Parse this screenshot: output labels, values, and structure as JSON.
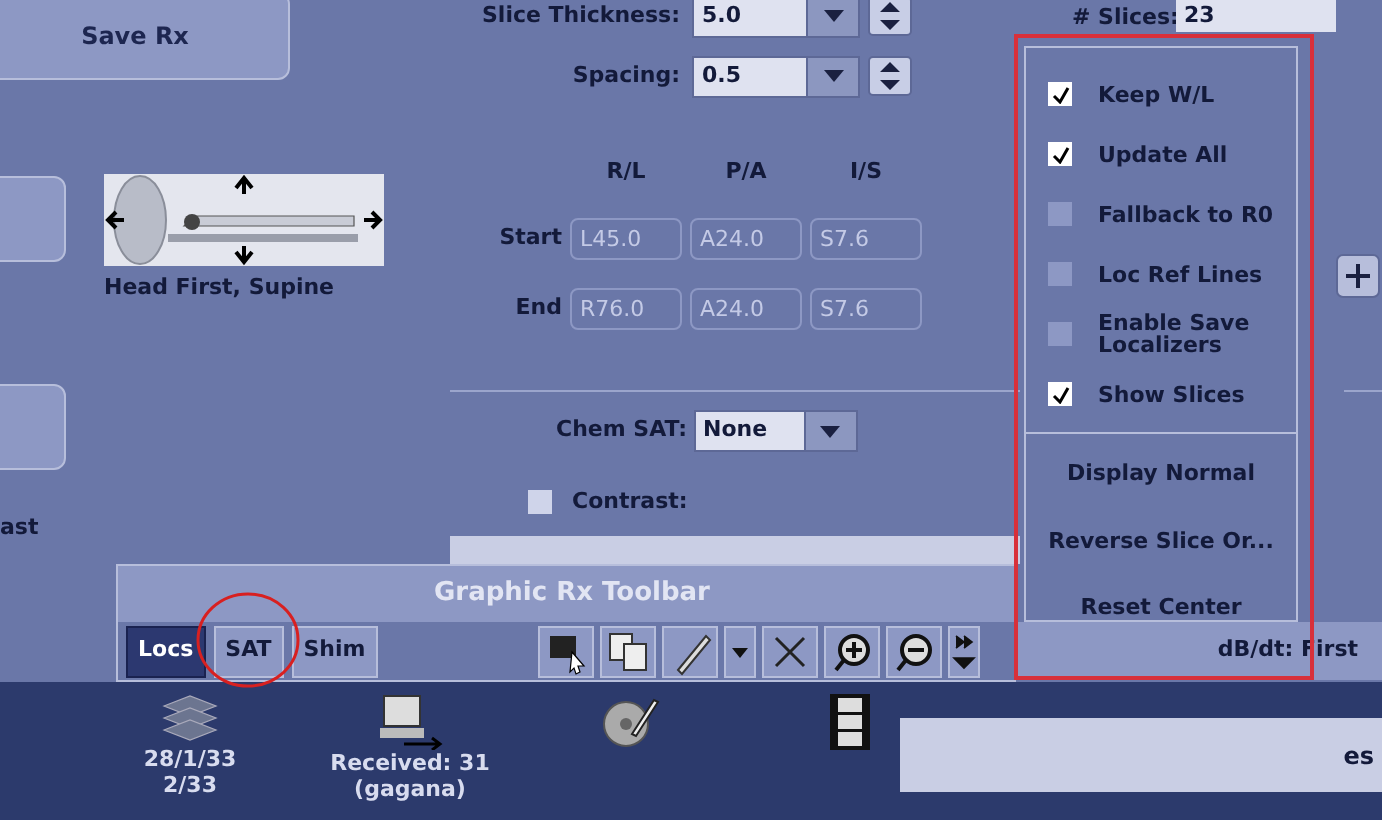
{
  "left_panel": {
    "save_button": "Save Rx",
    "cut_label": "ast",
    "patient_position": "Head First, Supine"
  },
  "slice_params": {
    "thickness_label": "Slice Thickness:",
    "thickness_value": "5.0",
    "spacing_label": "Spacing:",
    "spacing_value": "0.5",
    "slices_label": "# Slices:",
    "slices_value": "23"
  },
  "coords": {
    "columns": [
      "R/L",
      "P/A",
      "I/S"
    ],
    "rows": [
      {
        "label": "Start",
        "values": [
          "L45.0",
          "A24.0",
          "S7.6"
        ]
      },
      {
        "label": "End",
        "values": [
          "R76.0",
          "A24.0",
          "S7.6"
        ]
      }
    ]
  },
  "chem_sat": {
    "label": "Chem SAT:",
    "value": "None"
  },
  "contrast": {
    "label": "Contrast:",
    "checked": false
  },
  "menu": [
    {
      "kind": "check",
      "label": "Keep W/L",
      "checked": true
    },
    {
      "kind": "check",
      "label": "Update All",
      "checked": true
    },
    {
      "kind": "check",
      "label": "Fallback to R0",
      "checked": false
    },
    {
      "kind": "check",
      "label": "Loc Ref Lines",
      "checked": false
    },
    {
      "kind": "check",
      "label": "Enable Save Localizers",
      "checked": false
    },
    {
      "kind": "check",
      "label": "Show Slices",
      "checked": true
    },
    {
      "kind": "action",
      "label": "Display Normal"
    },
    {
      "kind": "action",
      "label": "Reverse Slice Or..."
    },
    {
      "kind": "action",
      "label": "Reset Center"
    }
  ],
  "toolbar": {
    "title": "Graphic Rx Toolbar",
    "tabs": [
      {
        "label": "Locs",
        "selected": true
      },
      {
        "label": "SAT",
        "selected": false
      },
      {
        "label": "Shim",
        "selected": false
      }
    ],
    "status": "dB/dt: First"
  },
  "taskbar": [
    {
      "kind": "stack",
      "lines": [
        "28/1/33",
        "2/33"
      ]
    },
    {
      "kind": "computer",
      "lines": [
        "Received: 31",
        "(gagana)"
      ]
    },
    {
      "kind": "disc"
    },
    {
      "kind": "film"
    }
  ],
  "taskbar_field": "es"
}
